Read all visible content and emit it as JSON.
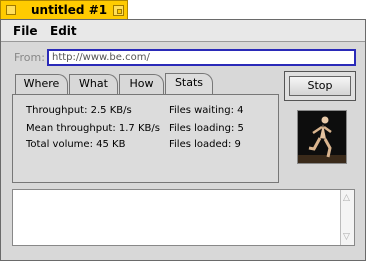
{
  "window": {
    "title": "untitled #1"
  },
  "menu": {
    "file": "File",
    "edit": "Edit"
  },
  "from": {
    "label": "From:",
    "url": "http://www.be.com/"
  },
  "tabs": [
    {
      "label": "Where"
    },
    {
      "label": "What"
    },
    {
      "label": "How"
    },
    {
      "label": "Stats",
      "active": true
    }
  ],
  "stats": {
    "throughput": "Throughput: 2.5 KB/s",
    "mean_throughput": "Mean throughput: 1.7 KB/s",
    "total_volume": "Total volume: 45 KB",
    "files_waiting": "Files waiting: 4",
    "files_loading": "Files loading: 5",
    "files_loaded": "Files loaded: 9"
  },
  "controls": {
    "stop": "Stop"
  },
  "log": {
    "text": ""
  }
}
